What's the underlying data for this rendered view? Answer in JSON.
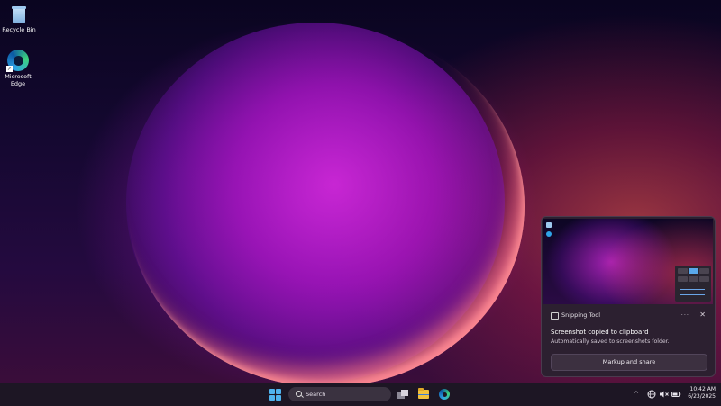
{
  "desktop": {
    "icons": [
      {
        "label": "Recycle Bin",
        "icon": "recycle-bin-icon"
      },
      {
        "label": "Microsoft Edge",
        "icon": "edge-icon"
      }
    ]
  },
  "notification": {
    "app_name": "Snipping Tool",
    "more_label": "···",
    "close_label": "✕",
    "title": "Screenshot copied to clipboard",
    "body": "Automatically saved to screenshots folder.",
    "action_label": "Markup and share"
  },
  "taskbar": {
    "search_label": "Search",
    "tray_chevron": "^",
    "clock_time": "10:42 AM",
    "clock_date": "6/23/2025",
    "accent_color": "#4fb3ee"
  }
}
